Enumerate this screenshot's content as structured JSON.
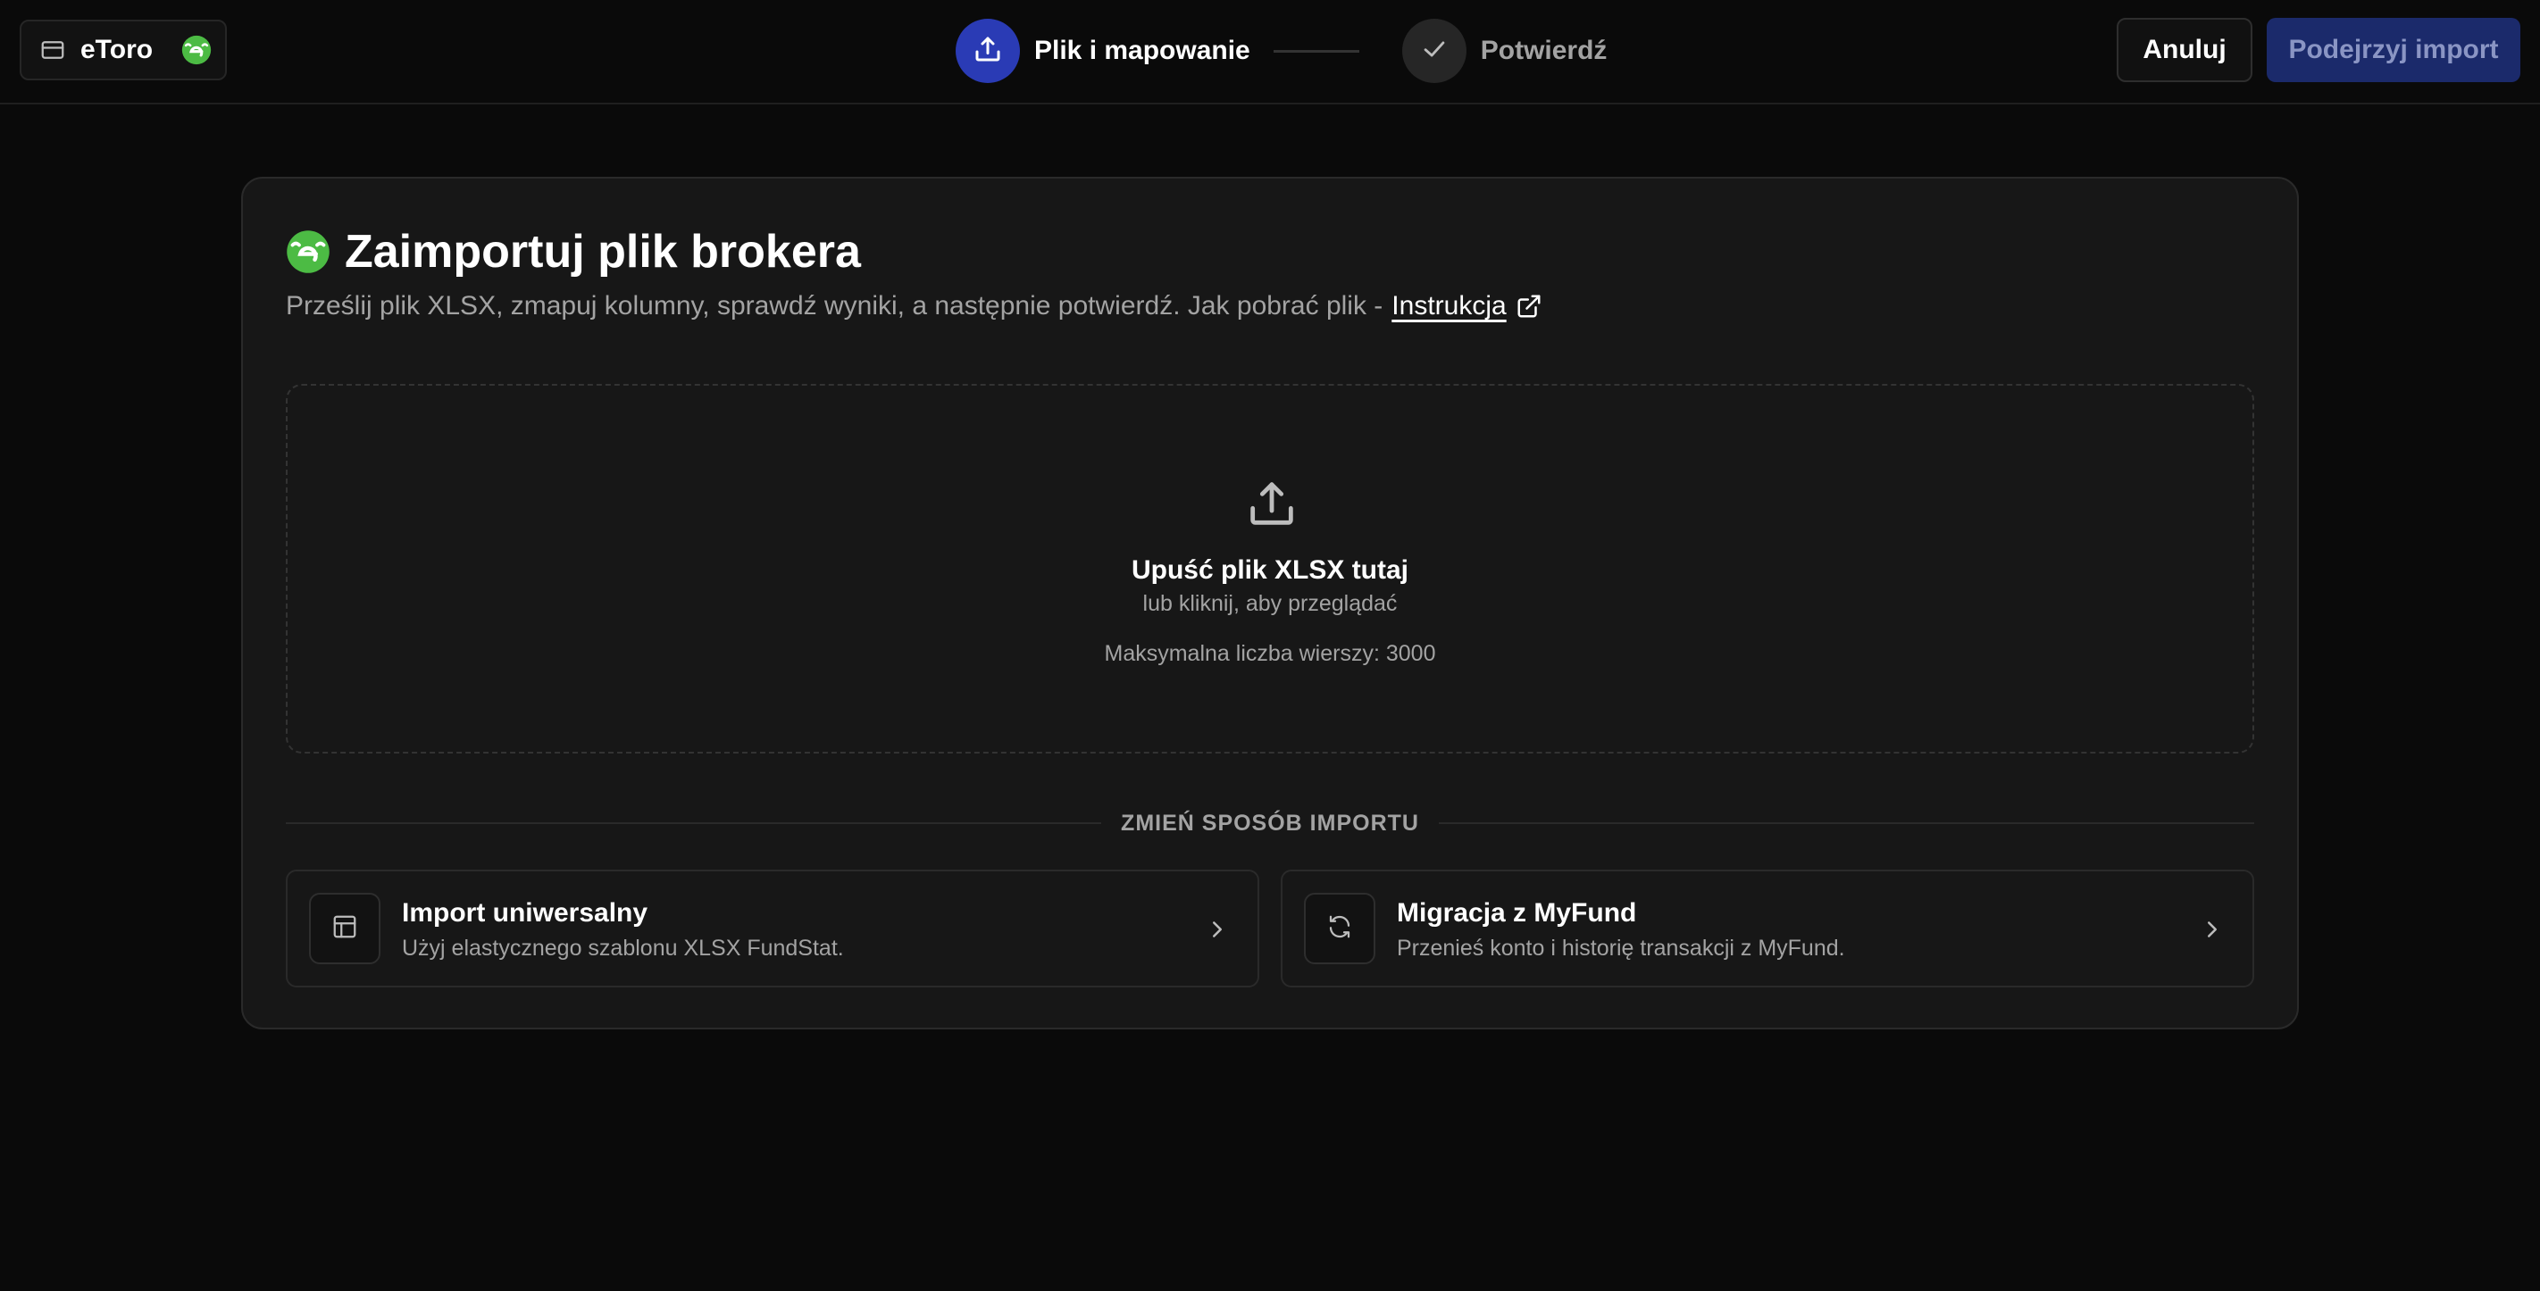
{
  "header": {
    "account_label": "eToro",
    "steps": [
      {
        "label": "Plik i mapowanie",
        "state": "active"
      },
      {
        "label": "Potwierdź",
        "state": "idle"
      }
    ],
    "cancel_label": "Anuluj",
    "preview_label": "Podejrzyj import"
  },
  "main": {
    "title": "Zaimportuj plik brokera",
    "subtitle": "Prześlij plik XLSX, zmapuj kolumny, sprawdź wyniki, a następnie potwierdź. Jak pobrać plik -",
    "instruction_link": "Instrukcja",
    "dropzone": {
      "title": "Upuść plik XLSX tutaj",
      "subtitle": "lub kliknij, aby przeglądać",
      "limit": "Maksymalna liczba wierszy: 3000"
    },
    "divider_label": "ZMIEŃ SPOSÓB IMPORTU",
    "options": [
      {
        "title": "Import uniwersalny",
        "description": "Użyj elastycznego szablonu XLSX FundStat."
      },
      {
        "title": "Migracja z MyFund",
        "description": "Przenieś konto i historię transakcji z MyFund."
      }
    ]
  },
  "colors": {
    "background": "#0a0a0a",
    "card": "#171717",
    "accent": "#2a3bb5",
    "preview_button": "#1b2a6b",
    "brand_green": "#4cbb44"
  },
  "icons": {
    "account": "wallet-icon",
    "brand": "etoro-logo-icon",
    "step_upload": "upload-icon",
    "step_confirm": "check-icon",
    "external_link": "external-link-icon",
    "dropzone": "upload-icon",
    "option_universal": "table-icon",
    "option_migration": "refresh-icon",
    "chevron": "chevron-right-icon"
  }
}
